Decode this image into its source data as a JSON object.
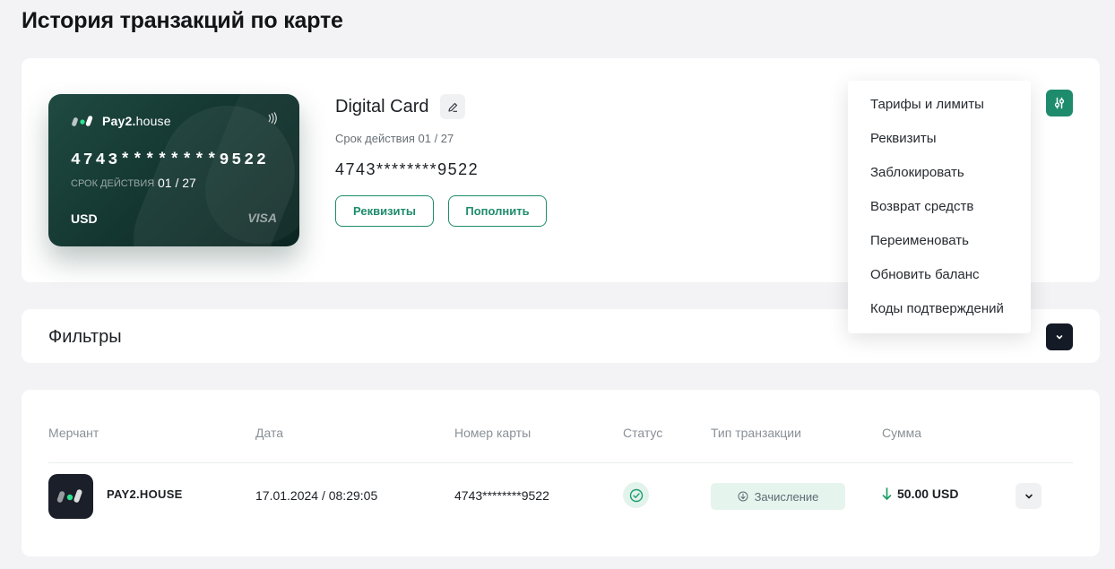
{
  "page": {
    "title": "История транзакций по карте"
  },
  "card": {
    "brand_bold": "Pay2.",
    "brand_light": "house",
    "number": "4743********9522",
    "exp_label": "СРОК ДЕЙСТВИЯ",
    "exp_value": "01 / 27",
    "currency": "USD",
    "network": "VISA"
  },
  "card_info": {
    "name": "Digital Card",
    "expiry": "Срок действия 01 / 27",
    "number": "4743********9522",
    "details_label": "Реквизиты",
    "topup_label": "Пополнить"
  },
  "menu": {
    "items": [
      {
        "label": "Тарифы и лимиты"
      },
      {
        "label": "Реквизиты"
      },
      {
        "label": "Заблокировать"
      },
      {
        "label": "Возврат средств"
      },
      {
        "label": "Переименовать"
      },
      {
        "label": "Обновить баланс"
      },
      {
        "label": "Коды подтверждений"
      }
    ]
  },
  "filters": {
    "title": "Фильтры"
  },
  "table": {
    "headers": {
      "merchant": "Мерчант",
      "date": "Дата",
      "card_number": "Номер карты",
      "status": "Статус",
      "type": "Тип транзакции",
      "amount": "Сумма"
    },
    "rows": [
      {
        "merchant": "PAY2.HOUSE",
        "date": "17.01.2024 / 08:29:05",
        "card_number": "4743********9522",
        "status": "success",
        "type": "Зачисление",
        "amount": "50.00 USD"
      }
    ]
  },
  "colors": {
    "accent": "#1e8c6c",
    "dark": "#141a26",
    "card_gradient_start": "#1f4a42",
    "card_gradient_end": "#0c2622",
    "income_arrow": "#1e9e6a"
  }
}
